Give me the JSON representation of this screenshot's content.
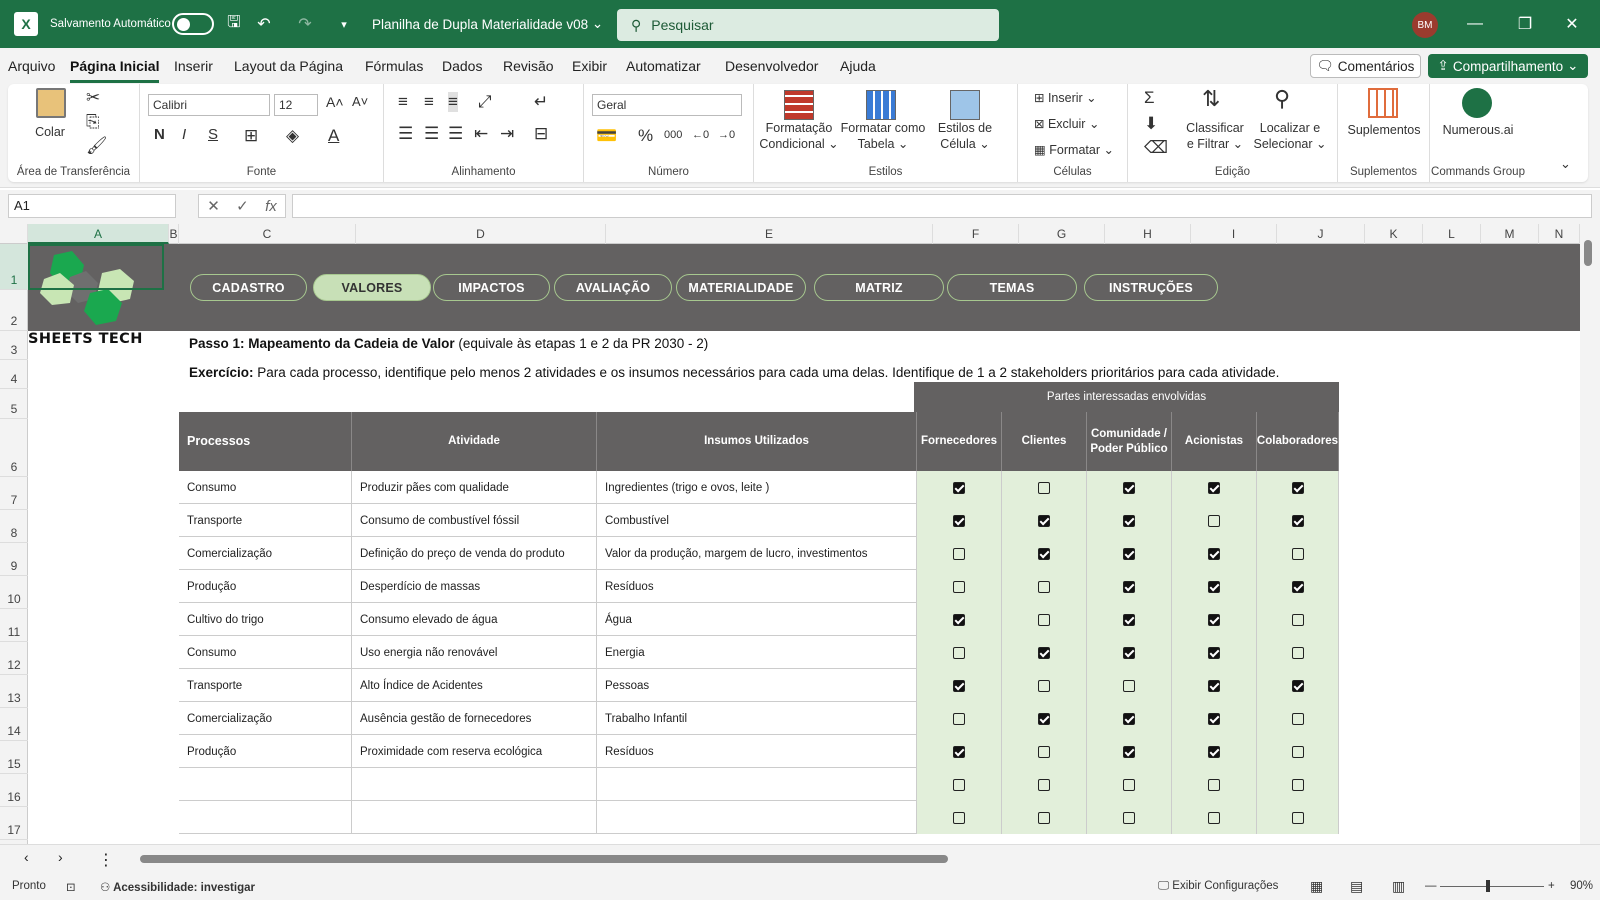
{
  "titlebar": {
    "app_icon": "excel-icon",
    "autosave_label": "Salvamento Automático",
    "doc_title": "Planilha de Dupla Materialidade v08",
    "search_placeholder": "Pesquisar",
    "user_initials": "BM"
  },
  "menu": {
    "items": [
      "Arquivo",
      "Página Inicial",
      "Inserir",
      "Layout da Página",
      "Fórmulas",
      "Dados",
      "Revisão",
      "Exibir",
      "Automatizar",
      "Desenvolvedor",
      "Ajuda"
    ],
    "active": "Página Inicial",
    "comments": "Comentários",
    "share": "Compartilhamento"
  },
  "ribbon": {
    "clipboard": {
      "label": "Área de Transferência",
      "paste": "Colar"
    },
    "font": {
      "label": "Fonte",
      "family": "Calibri",
      "size": "12",
      "bold": "N",
      "italic": "I",
      "underline": "S"
    },
    "alignment": {
      "label": "Alinhamento"
    },
    "number": {
      "label": "Número",
      "format": "Geral"
    },
    "styles": {
      "label": "Estilos",
      "cond1": "Formatação",
      "cond2": "Condicional",
      "table1": "Formatar como",
      "table2": "Tabela",
      "cell1": "Estilos de",
      "cell2": "Célula"
    },
    "cells": {
      "label": "Células",
      "insert": "Inserir",
      "delete": "Excluir",
      "format": "Formatar"
    },
    "editing": {
      "label": "Edição",
      "sort1": "Classificar",
      "sort2": "e Filtrar",
      "find1": "Localizar e",
      "find2": "Selecionar"
    },
    "addins": {
      "label": "Suplementos",
      "button": "Suplementos"
    },
    "commands": {
      "label": "Commands Group",
      "button": "Numerous.ai"
    }
  },
  "formulabar": {
    "namebox": "A1",
    "fx": "fx",
    "formula": ""
  },
  "columns": [
    "A",
    "B",
    "C",
    "D",
    "E",
    "F",
    "G",
    "H",
    "I",
    "J",
    "K",
    "L",
    "M",
    "N"
  ],
  "rows": [
    "1",
    "2",
    "3",
    "4",
    "5",
    "6",
    "7",
    "8",
    "9",
    "10",
    "11",
    "12",
    "13",
    "14",
    "15",
    "16",
    "17"
  ],
  "sheet": {
    "nav_tabs": [
      "CADASTRO",
      "VALORES",
      "IMPACTOS",
      "AVALIAÇÃO",
      "MATERIALIDADE",
      "MATRIZ",
      "TEMAS",
      "INSTRUÇÕES"
    ],
    "active_tab": "VALORES",
    "brand": "SHEETS TECH",
    "step_bold": "Passo 1: Mapeamento da Cadeia de Valor",
    "step_rest": " (equivale às etapas 1 e 2 da PR 2030 - 2)",
    "exercise_bold": "Exercício:",
    "exercise_rest": " Para cada processo, identifique pelo menos 2 atividades e os insumos necessários para cada uma delas. Identifique de 1 a 2 stakeholders prioritários para cada atividade.",
    "stakeholders_header": "Partes interessadas envolvidas",
    "headers": {
      "process": "Processos",
      "activity": "Atividade",
      "inputs": "Insumos Utilizados",
      "suppliers": "Fornecedores",
      "clients": "Clientes",
      "community1": "Comunidade /",
      "community2": "Poder Público",
      "shareholders": "Acionistas",
      "employees": "Colaboradores"
    },
    "table_rows": [
      {
        "process": "Consumo",
        "activity": "Produzir pães com qualidade",
        "inputs": "Ingredientes (trigo e ovos, leite )",
        "checks": [
          true,
          false,
          true,
          true,
          true
        ]
      },
      {
        "process": "Transporte",
        "activity": "Consumo de combustível fóssil",
        "inputs": "Combustível",
        "checks": [
          true,
          true,
          true,
          false,
          true
        ]
      },
      {
        "process": "Comercialização",
        "activity": "Definição do preço de venda do produto",
        "inputs": "Valor da produção, margem de lucro, investimentos",
        "checks": [
          false,
          true,
          true,
          true,
          false
        ]
      },
      {
        "process": "Produção",
        "activity": "Desperdício de massas",
        "inputs": "Resíduos",
        "checks": [
          false,
          false,
          true,
          true,
          true
        ]
      },
      {
        "process": "Cultivo do trigo",
        "activity": "Consumo elevado de água",
        "inputs": "Água",
        "checks": [
          true,
          false,
          true,
          true,
          false
        ]
      },
      {
        "process": "Consumo",
        "activity": "Uso energia não renovável",
        "inputs": "Energia",
        "checks": [
          false,
          true,
          true,
          true,
          false
        ]
      },
      {
        "process": "Transporte",
        "activity": "Alto Índice de Acidentes",
        "inputs": "Pessoas",
        "checks": [
          true,
          false,
          false,
          true,
          true
        ]
      },
      {
        "process": "Comercialização",
        "activity": "Ausência gestão de fornecedores",
        "inputs": "Trabalho Infantil",
        "checks": [
          false,
          true,
          true,
          true,
          false
        ]
      },
      {
        "process": "Produção",
        "activity": "Proximidade com reserva ecológica",
        "inputs": "Resíduos",
        "checks": [
          true,
          false,
          true,
          true,
          false
        ]
      },
      {
        "process": "",
        "activity": "",
        "inputs": "",
        "checks": [
          false,
          false,
          false,
          false,
          false
        ]
      },
      {
        "process": "",
        "activity": "",
        "inputs": "",
        "checks": [
          false,
          false,
          false,
          false,
          false
        ]
      }
    ]
  },
  "statusbar": {
    "ready": "Pronto",
    "accessibility": "Acessibilidade: investigar",
    "display": "Exibir Configurações",
    "zoom": "90%"
  }
}
